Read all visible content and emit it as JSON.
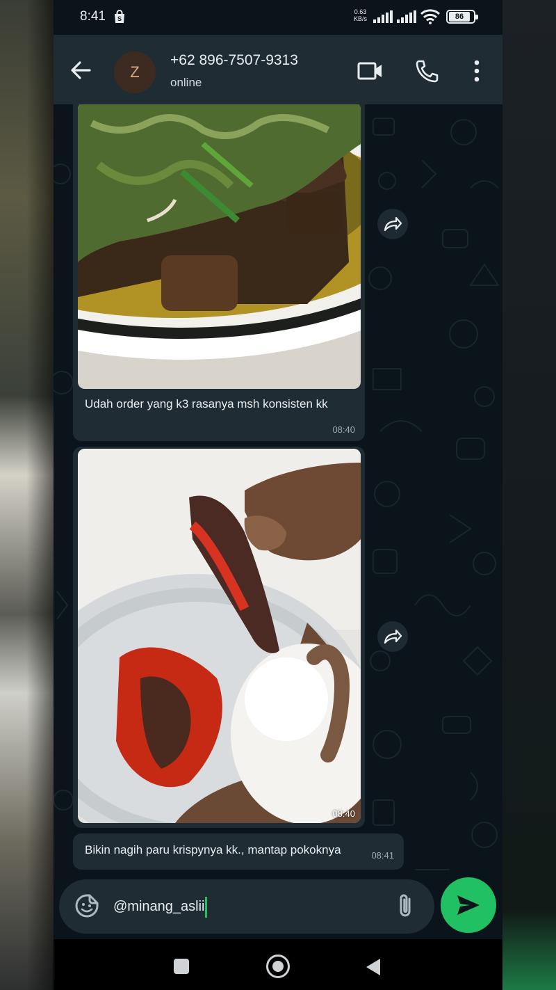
{
  "status_bar": {
    "time": "8:41",
    "net_speed_value": "0.63",
    "net_speed_unit": "KB/s",
    "battery": "86"
  },
  "header": {
    "avatar_initial": "Z",
    "contact_name": "+62 896-7507-9313",
    "contact_status": "online"
  },
  "messages": [
    {
      "type": "image",
      "image_desc": "tempe with green chili",
      "caption": "Udah order yang k3 rasanya msh konsisten kk",
      "time": "08:40"
    },
    {
      "type": "image",
      "image_desc": "crispy lung with red sambal and rice",
      "caption": "",
      "time": "08:40"
    },
    {
      "type": "text",
      "caption": "Bikin nagih paru krispynya kk., mantap pokoknya",
      "time": "08:41"
    }
  ],
  "composer": {
    "value": "@minang_aslii"
  },
  "colors": {
    "accent": "#21c063",
    "bubble": "#1f2c34",
    "background": "#0b141a",
    "header": "#1f2c34"
  },
  "icons": {
    "back": "back-arrow-icon",
    "video": "video-call-icon",
    "call": "phone-icon",
    "menu": "more-vertical-icon",
    "forward": "forward-icon",
    "sticker": "sticker-icon",
    "attach": "paperclip-icon",
    "send": "send-icon"
  }
}
